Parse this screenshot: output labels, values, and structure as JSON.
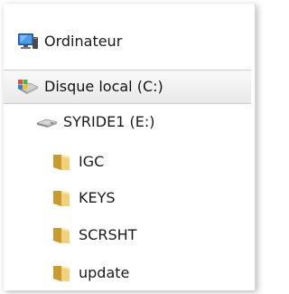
{
  "tree": {
    "items": [
      {
        "label": "Ordinateur",
        "icon": "computer-icon"
      },
      {
        "label": "Disque local (C:)",
        "icon": "local-disk-icon",
        "selected": true
      },
      {
        "label": "SYRIDE1 (E:)",
        "icon": "removable-drive-icon"
      },
      {
        "label": "IGC",
        "icon": "folder-icon"
      },
      {
        "label": "KEYS",
        "icon": "folder-icon"
      },
      {
        "label": "SCRSHT",
        "icon": "folder-icon"
      },
      {
        "label": "update",
        "icon": "folder-icon"
      }
    ]
  },
  "colors": {
    "selection_background": "#eeeeee",
    "folder": "#e8c45a",
    "monitor": "#2f6fd0"
  }
}
